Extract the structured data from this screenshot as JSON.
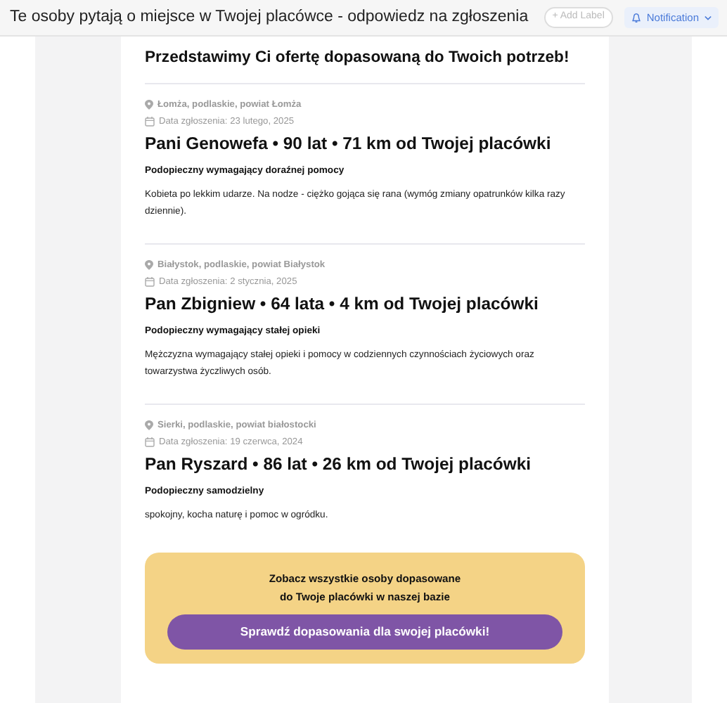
{
  "header": {
    "subject": "Te osoby pytają o miejsce w Twojej placówce - odpowiedz na zgłoszenia",
    "add_label": "+ Add Label",
    "notification": "Notification"
  },
  "heading": "Przedstawimy Ci ofertę dopasowaną do Twoich potrzeb!",
  "requests": [
    {
      "location": "Łomża, podlaskie, powiat Łomża",
      "date": "Data zgłoszenia: 23 lutego, 2025",
      "title": "Pani Genowefa • 90 lat • 71 km od Twojej placówki",
      "care_type": "Podopieczny wymagający doraźnej pomocy",
      "description": "Kobieta po lekkim udarze. Na nodze - ciężko gojąca się rana (wymóg zmiany opatrunków kilka razy dziennie)."
    },
    {
      "location": "Białystok, podlaskie, powiat Białystok",
      "date": "Data zgłoszenia: 2 stycznia, 2025",
      "title": "Pan Zbigniew • 64 lata • 4 km od Twojej placówki",
      "care_type": "Podopieczny wymagający stałej opieki",
      "description": "Mężczyzna wymagający stałej opieki i pomocy w codziennych czynnościach życiowych oraz towarzystwa życzliwych osób."
    },
    {
      "location": "Sierki, podlaskie, powiat białostocki",
      "date": "Data zgłoszenia: 19 czerwca, 2024",
      "title": "Pan Ryszard • 86 lat • 26 km od Twojej placówki",
      "care_type": "Podopieczny samodzielny",
      "description": "spokojny, kocha naturę i pomoc w ogródku."
    }
  ],
  "cta": {
    "lines": [
      "Zobacz wszystkie osoby dopasowane",
      "do Twoje placówki w naszej bazie"
    ],
    "button": "Sprawdź dopasowania dla swojej placówki!"
  }
}
